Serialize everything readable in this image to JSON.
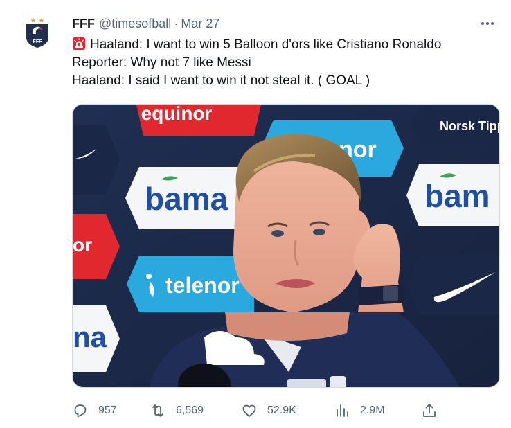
{
  "author": {
    "name": "FFF",
    "handle": "@timesofball",
    "separator": "·",
    "date": "Mar 27",
    "avatar_text": "FFF"
  },
  "tweet": {
    "lines": [
      "Haaland: I want to win 5 Balloon d'ors like Cristiano Ronaldo",
      "Reporter: Why not 7 like Messi",
      "Haaland: I said I want to win it not steal it. ( GOAL )"
    ],
    "leading_emoji": "police-car-light-icon"
  },
  "media": {
    "sponsor_labels": {
      "equinor": "equinor",
      "norsk_tipping": "Norsk Tipp",
      "bama_left": "bama",
      "bama_right": "bam",
      "telenor": "telenor",
      "nor_partial": "nor",
      "or_partial": "or",
      "na_partial": "na"
    },
    "colors": {
      "backdrop": "#1c2a4a",
      "equinor_red": "#e0282e",
      "telenor_blue": "#2aa9df",
      "bama_white": "#f4f6f8",
      "bama_text": "#1f4ea3"
    }
  },
  "metrics": {
    "replies": "957",
    "retweets": "6,569",
    "likes": "52.9K",
    "views": "2.9M"
  },
  "icons": {
    "reply": "reply-icon",
    "retweet": "retweet-icon",
    "like": "heart-icon",
    "views": "views-icon",
    "share": "share-icon",
    "more": "more-icon"
  }
}
